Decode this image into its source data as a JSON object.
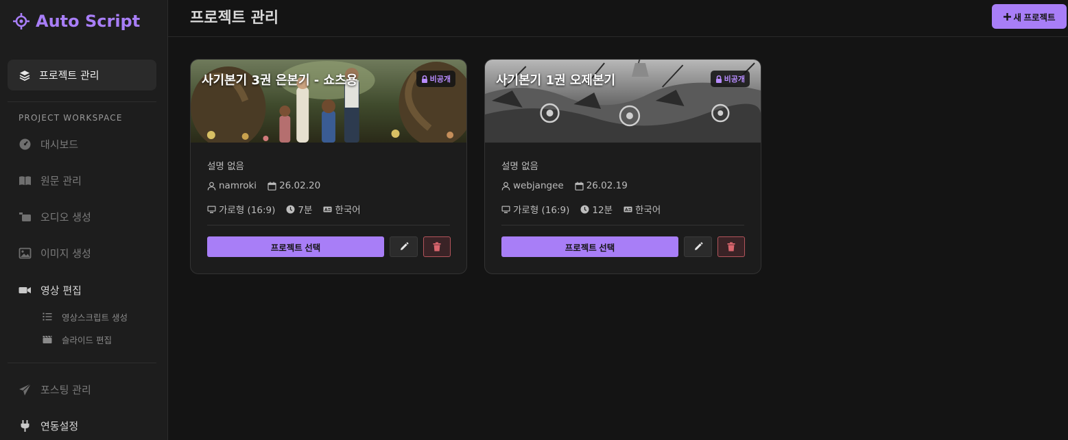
{
  "app": {
    "name": "Auto Script",
    "accent": "#a87ef7"
  },
  "sidebar": {
    "active_item": {
      "label": "프로젝트 관리",
      "icon": "layers-icon"
    },
    "section_label": "PROJECT WORKSPACE",
    "items": [
      {
        "label": "대시보드",
        "icon": "dashboard-gauge-icon"
      },
      {
        "label": "원문 관리",
        "icon": "book-open-icon"
      },
      {
        "label": "오디오 생성",
        "icon": "audio-icon"
      },
      {
        "label": "이미지 생성",
        "icon": "image-icon"
      },
      {
        "label": "영상 편집",
        "icon": "video-camera-icon"
      }
    ],
    "sub_items": [
      {
        "label": "영상스크립트 생성",
        "icon": "list-ordered-icon"
      },
      {
        "label": "슬라이드 편집",
        "icon": "clapperboard-icon"
      }
    ],
    "bottom_items": [
      {
        "label": "포스팅 관리",
        "icon": "paper-plane-icon"
      },
      {
        "label": "연동설정",
        "icon": "plug-icon"
      }
    ]
  },
  "header": {
    "title": "프로젝트 관리",
    "new_project_label": "새 프로젝트"
  },
  "projects": [
    {
      "title": "사기본기 3권 은본기 - 쇼츠용",
      "visibility": "비공개",
      "description": "설명 없음",
      "author": "namroki",
      "date": "26.02.20",
      "format": "가로형 (16:9)",
      "duration": "7분",
      "language": "한국어",
      "select_label": "프로젝트 선택"
    },
    {
      "title": "사기본기 1권 오제본기",
      "visibility": "비공개",
      "description": "설명 없음",
      "author": "webjangee",
      "date": "26.02.19",
      "format": "가로형 (16:9)",
      "duration": "12분",
      "language": "한국어",
      "select_label": "프로젝트 선택"
    }
  ]
}
